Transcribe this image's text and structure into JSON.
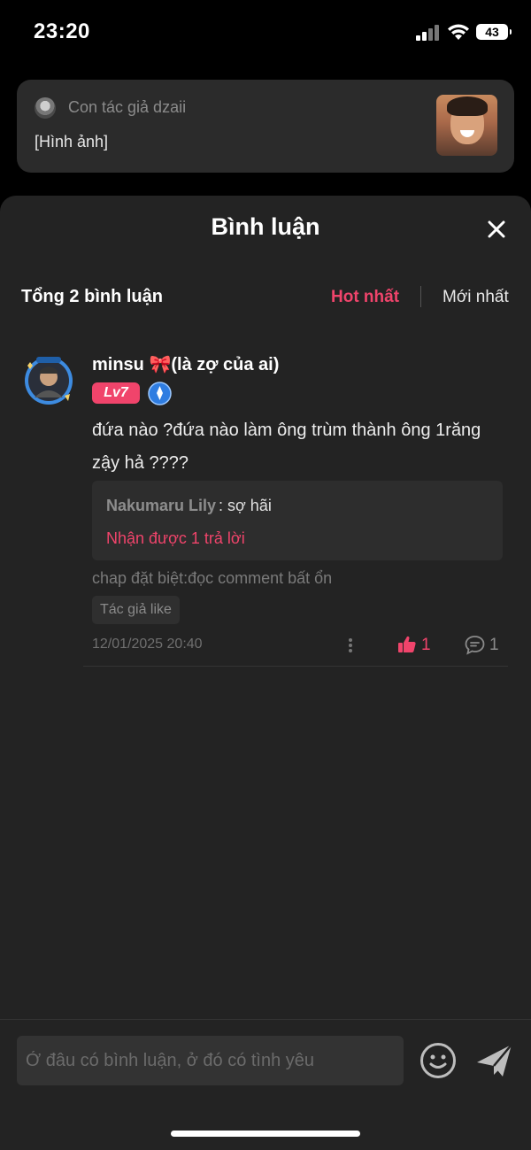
{
  "status_bar": {
    "time": "23:20",
    "battery": "43"
  },
  "notification": {
    "author": "Con tác giả dzaii",
    "content": "[Hình ảnh]"
  },
  "sheet": {
    "title": "Bình luận",
    "total": "Tổng 2 bình luận",
    "sort_hot": "Hot nhất",
    "sort_new": "Mới nhất"
  },
  "comment": {
    "user": "minsu 🎀(là zợ của ai)",
    "level": "Lv7",
    "text": "đứa nào ?đứa nào làm ông trùm thành ông 1răng zậy hả ????",
    "reply_user": "Nakumaru Lily",
    "reply_colon": ":",
    "reply_text": "sợ hãi",
    "reply_link": "Nhận được 1 trả lời",
    "chapter": "chap đặt biệt:đọc comment bất ổn",
    "tag": "Tác giả like",
    "date": "12/01/2025 20:40",
    "likes": "1",
    "replies": "1"
  },
  "input": {
    "placeholder": "Ở đâu có bình luận, ở đó có tình yêu"
  },
  "colors": {
    "accent": "#f0446b",
    "sheet_bg": "#232323"
  }
}
